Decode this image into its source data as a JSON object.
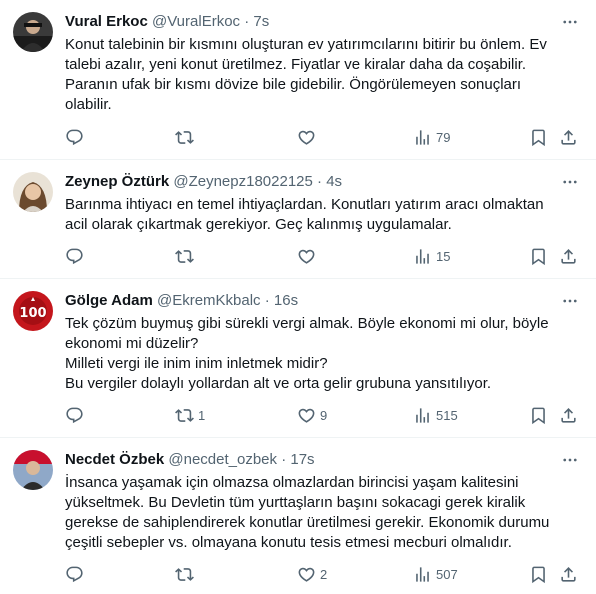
{
  "tweets": [
    {
      "name": "Vural Erkoc",
      "handle": "@VuralErkoc",
      "dot": "·",
      "time": "7s",
      "lines": [
        "Konut talebinin bir kısmını oluşturan ev yatırımcılarını bitirir bu önlem. Ev",
        "talebi azalır, yeni konut üretilmez. Fiyatlar ve kiralar daha da coşabilir.",
        "Paranın ufak bir kısmı dövize bile gidebilir. Öngörülemeyen sonuçları",
        "olabilir."
      ],
      "retweets": "",
      "likes": "",
      "views": "79"
    },
    {
      "name": "Zeynep Öztürk",
      "handle": "@Zeynepz18022125",
      "dot": "·",
      "time": "4s",
      "lines": [
        "Barınma ihtiyacı en temel ihtiyaçlardan. Konutları yatırım aracı olmaktan",
        "acil olarak çıkartmak gerekiyor. Geç kalınmış uygulamalar."
      ],
      "retweets": "",
      "likes": "",
      "views": "15"
    },
    {
      "name": "Gölge Adam",
      "handle": "@EkremKkbalc",
      "dot": "·",
      "time": "16s",
      "lines": [
        "Tek çözüm buymuş gibi sürekli vergi almak. Böyle ekonomi mi olur, böyle",
        "ekonomi mi düzelir?",
        "Milleti vergi ile inim inim inletmek midir?",
        "Bu vergiler dolaylı yollardan alt ve orta gelir grubuna yansıtılıyor."
      ],
      "retweets": "1",
      "likes": "9",
      "views": "515"
    },
    {
      "name": "Necdet Özbek",
      "handle": "@necdet_ozbek",
      "dot": "·",
      "time": "17s",
      "lines": [
        "İnsanca yaşamak için olmazsa olmazlardan birincisi yaşam kalitesini",
        "yükseltmek. Bu Devletin tüm yurttaşların başını sokacagi gerek kiralik",
        "gerekse de sahiplendirerek konutlar üretilmesi gerekir. Ekonomik durumu",
        "çeşitli sebepler vs. olmayana konutu tesis etmesi mecburi olmalıdır."
      ],
      "retweets": "",
      "likes": "2",
      "views": "507"
    }
  ],
  "icons": {
    "reply": "reply-icon",
    "retweet": "retweet-icon",
    "like": "like-icon",
    "views": "views-icon",
    "bookmark": "bookmark-icon",
    "share": "share-icon",
    "more": "more-icon"
  },
  "colors": {
    "text": "#0f1419",
    "secondary": "#536471",
    "border": "#eff3f4"
  }
}
